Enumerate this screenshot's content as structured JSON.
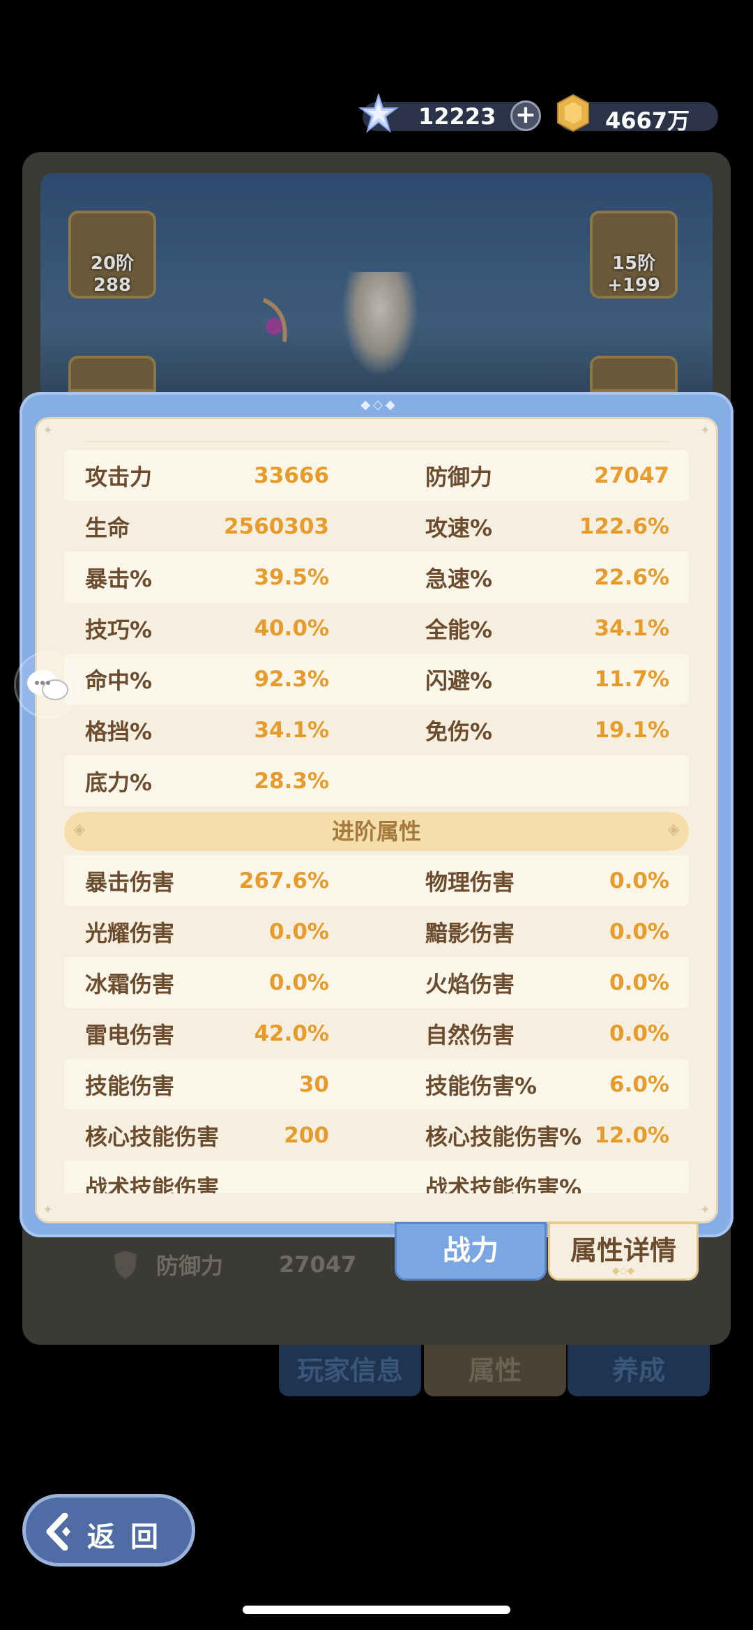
{
  "currency": {
    "gems": "12223",
    "gold": "4667万"
  },
  "equipment": {
    "slot_left_label": "20阶 288",
    "slot_right_label": "15阶+199"
  },
  "background_stat": {
    "label": "防御力",
    "value": "27047"
  },
  "basic_stats": [
    {
      "left": {
        "name": "攻击力",
        "value": "33666"
      },
      "right": {
        "name": "防御力",
        "value": "27047"
      }
    },
    {
      "left": {
        "name": "生命",
        "value": "2560303"
      },
      "right": {
        "name": "攻速%",
        "value": "122.6%"
      }
    },
    {
      "left": {
        "name": "暴击%",
        "value": "39.5%"
      },
      "right": {
        "name": "急速%",
        "value": "22.6%"
      }
    },
    {
      "left": {
        "name": "技巧%",
        "value": "40.0%"
      },
      "right": {
        "name": "全能%",
        "value": "34.1%"
      }
    },
    {
      "left": {
        "name": "命中%",
        "value": "92.3%"
      },
      "right": {
        "name": "闪避%",
        "value": "11.7%"
      }
    },
    {
      "left": {
        "name": "格挡%",
        "value": "34.1%"
      },
      "right": {
        "name": "免伤%",
        "value": "19.1%"
      }
    },
    {
      "left": {
        "name": "底力%",
        "value": "28.3%"
      },
      "right": {
        "name": "",
        "value": ""
      }
    }
  ],
  "advanced_section_title": "进阶属性",
  "advanced_stats": [
    {
      "left": {
        "name": "暴击伤害",
        "value": "267.6%"
      },
      "right": {
        "name": "物理伤害",
        "value": "0.0%"
      }
    },
    {
      "left": {
        "name": "光耀伤害",
        "value": "0.0%"
      },
      "right": {
        "name": "黯影伤害",
        "value": "0.0%"
      }
    },
    {
      "left": {
        "name": "冰霜伤害",
        "value": "0.0%"
      },
      "right": {
        "name": "火焰伤害",
        "value": "0.0%"
      }
    },
    {
      "left": {
        "name": "雷电伤害",
        "value": "42.0%"
      },
      "right": {
        "name": "自然伤害",
        "value": "0.0%"
      }
    },
    {
      "left": {
        "name": "技能伤害",
        "value": "30"
      },
      "right": {
        "name": "技能伤害%",
        "value": "6.0%"
      }
    },
    {
      "left": {
        "name": "核心技能伤害",
        "value": "200"
      },
      "right": {
        "name": "核心技能伤害%",
        "value": "12.0%"
      }
    },
    {
      "left": {
        "name": "战术技能伤害",
        "value": ""
      },
      "right": {
        "name": "战术技能伤害%",
        "value": ""
      }
    }
  ],
  "buttons": {
    "power": "战力",
    "details": "属性详情"
  },
  "tabs": {
    "player_info": "玩家信息",
    "attributes": "属性",
    "growth": "养成"
  },
  "back_label": "返回",
  "colors": {
    "stat_value": "#e69b2a",
    "stat_name": "#6b4c2f",
    "dialog_frame": "#86aee6",
    "panel_bg": "#f6efdf"
  }
}
